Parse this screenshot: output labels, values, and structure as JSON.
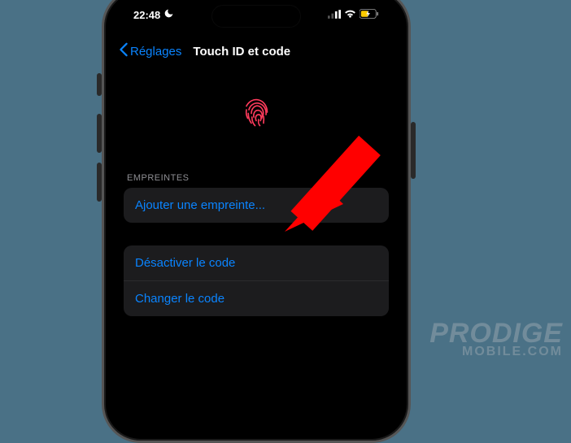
{
  "status": {
    "time": "22:48",
    "moon_icon": "moon-icon"
  },
  "nav": {
    "back_label": "Réglages",
    "title": "Touch ID et code"
  },
  "sections": {
    "fingerprints_header": "EMPREINTES",
    "add_fingerprint": "Ajouter une empreinte...",
    "disable_code": "Désactiver le code",
    "change_code": "Changer le code"
  },
  "watermark": {
    "line1": "PRODIGE",
    "line2": "MOBILE.COM"
  }
}
